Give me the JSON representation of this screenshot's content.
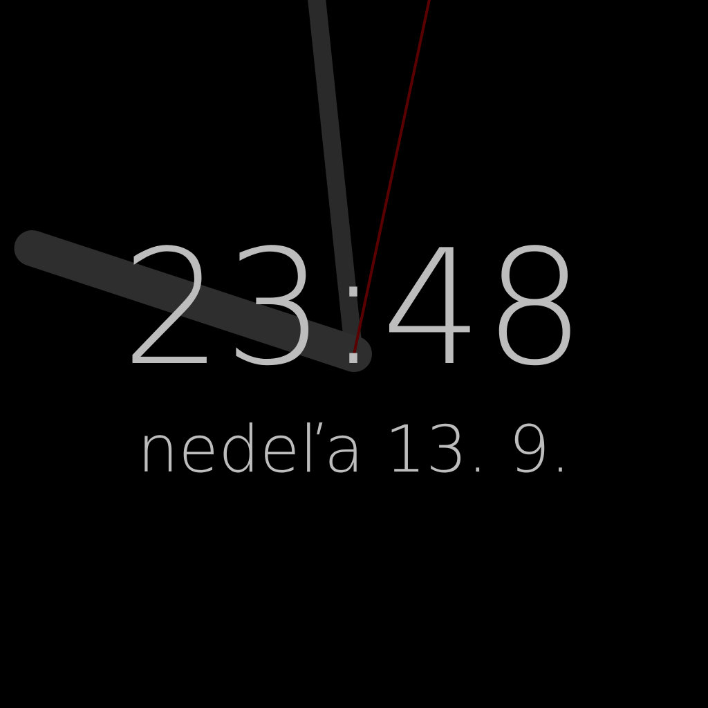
{
  "clock": {
    "time_text": "23:48",
    "date_text": "nedeľa 13. 9.",
    "hour": 23,
    "minute": 48,
    "second": 2
  },
  "colors": {
    "background": "#000000",
    "text": "#bdbdbd",
    "hand": "#2a2a2a",
    "second_hand": "#5a0000"
  }
}
